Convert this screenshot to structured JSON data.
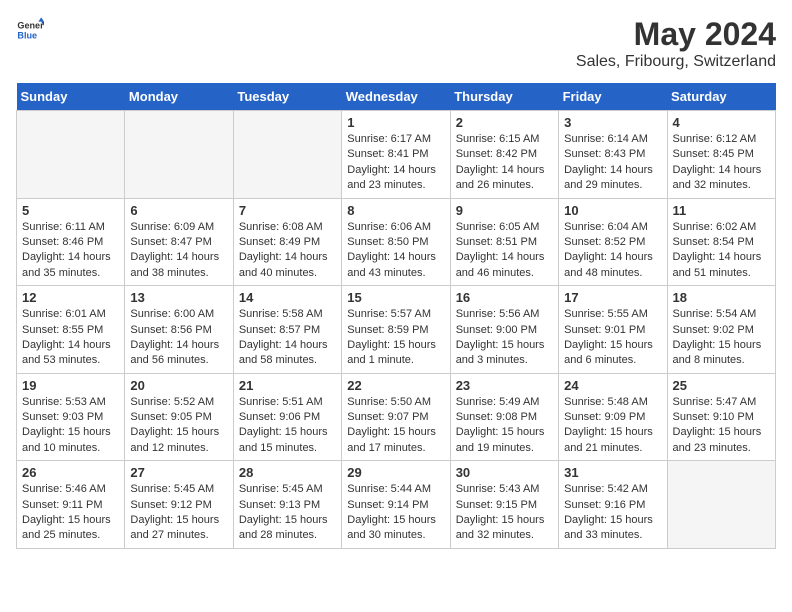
{
  "logo": {
    "general": "General",
    "blue": "Blue"
  },
  "title": "May 2024",
  "subtitle": "Sales, Fribourg, Switzerland",
  "headers": [
    "Sunday",
    "Monday",
    "Tuesday",
    "Wednesday",
    "Thursday",
    "Friday",
    "Saturday"
  ],
  "weeks": [
    [
      {
        "day": "",
        "empty": true
      },
      {
        "day": "",
        "empty": true
      },
      {
        "day": "",
        "empty": true
      },
      {
        "day": "1",
        "sunrise": "6:17 AM",
        "sunset": "8:41 PM",
        "daylight": "14 hours and 23 minutes."
      },
      {
        "day": "2",
        "sunrise": "6:15 AM",
        "sunset": "8:42 PM",
        "daylight": "14 hours and 26 minutes."
      },
      {
        "day": "3",
        "sunrise": "6:14 AM",
        "sunset": "8:43 PM",
        "daylight": "14 hours and 29 minutes."
      },
      {
        "day": "4",
        "sunrise": "6:12 AM",
        "sunset": "8:45 PM",
        "daylight": "14 hours and 32 minutes."
      }
    ],
    [
      {
        "day": "5",
        "sunrise": "6:11 AM",
        "sunset": "8:46 PM",
        "daylight": "14 hours and 35 minutes."
      },
      {
        "day": "6",
        "sunrise": "6:09 AM",
        "sunset": "8:47 PM",
        "daylight": "14 hours and 38 minutes."
      },
      {
        "day": "7",
        "sunrise": "6:08 AM",
        "sunset": "8:49 PM",
        "daylight": "14 hours and 40 minutes."
      },
      {
        "day": "8",
        "sunrise": "6:06 AM",
        "sunset": "8:50 PM",
        "daylight": "14 hours and 43 minutes."
      },
      {
        "day": "9",
        "sunrise": "6:05 AM",
        "sunset": "8:51 PM",
        "daylight": "14 hours and 46 minutes."
      },
      {
        "day": "10",
        "sunrise": "6:04 AM",
        "sunset": "8:52 PM",
        "daylight": "14 hours and 48 minutes."
      },
      {
        "day": "11",
        "sunrise": "6:02 AM",
        "sunset": "8:54 PM",
        "daylight": "14 hours and 51 minutes."
      }
    ],
    [
      {
        "day": "12",
        "sunrise": "6:01 AM",
        "sunset": "8:55 PM",
        "daylight": "14 hours and 53 minutes."
      },
      {
        "day": "13",
        "sunrise": "6:00 AM",
        "sunset": "8:56 PM",
        "daylight": "14 hours and 56 minutes."
      },
      {
        "day": "14",
        "sunrise": "5:58 AM",
        "sunset": "8:57 PM",
        "daylight": "14 hours and 58 minutes."
      },
      {
        "day": "15",
        "sunrise": "5:57 AM",
        "sunset": "8:59 PM",
        "daylight": "15 hours and 1 minute."
      },
      {
        "day": "16",
        "sunrise": "5:56 AM",
        "sunset": "9:00 PM",
        "daylight": "15 hours and 3 minutes."
      },
      {
        "day": "17",
        "sunrise": "5:55 AM",
        "sunset": "9:01 PM",
        "daylight": "15 hours and 6 minutes."
      },
      {
        "day": "18",
        "sunrise": "5:54 AM",
        "sunset": "9:02 PM",
        "daylight": "15 hours and 8 minutes."
      }
    ],
    [
      {
        "day": "19",
        "sunrise": "5:53 AM",
        "sunset": "9:03 PM",
        "daylight": "15 hours and 10 minutes."
      },
      {
        "day": "20",
        "sunrise": "5:52 AM",
        "sunset": "9:05 PM",
        "daylight": "15 hours and 12 minutes."
      },
      {
        "day": "21",
        "sunrise": "5:51 AM",
        "sunset": "9:06 PM",
        "daylight": "15 hours and 15 minutes."
      },
      {
        "day": "22",
        "sunrise": "5:50 AM",
        "sunset": "9:07 PM",
        "daylight": "15 hours and 17 minutes."
      },
      {
        "day": "23",
        "sunrise": "5:49 AM",
        "sunset": "9:08 PM",
        "daylight": "15 hours and 19 minutes."
      },
      {
        "day": "24",
        "sunrise": "5:48 AM",
        "sunset": "9:09 PM",
        "daylight": "15 hours and 21 minutes."
      },
      {
        "day": "25",
        "sunrise": "5:47 AM",
        "sunset": "9:10 PM",
        "daylight": "15 hours and 23 minutes."
      }
    ],
    [
      {
        "day": "26",
        "sunrise": "5:46 AM",
        "sunset": "9:11 PM",
        "daylight": "15 hours and 25 minutes."
      },
      {
        "day": "27",
        "sunrise": "5:45 AM",
        "sunset": "9:12 PM",
        "daylight": "15 hours and 27 minutes."
      },
      {
        "day": "28",
        "sunrise": "5:45 AM",
        "sunset": "9:13 PM",
        "daylight": "15 hours and 28 minutes."
      },
      {
        "day": "29",
        "sunrise": "5:44 AM",
        "sunset": "9:14 PM",
        "daylight": "15 hours and 30 minutes."
      },
      {
        "day": "30",
        "sunrise": "5:43 AM",
        "sunset": "9:15 PM",
        "daylight": "15 hours and 32 minutes."
      },
      {
        "day": "31",
        "sunrise": "5:42 AM",
        "sunset": "9:16 PM",
        "daylight": "15 hours and 33 minutes."
      },
      {
        "day": "",
        "empty": true
      }
    ]
  ]
}
